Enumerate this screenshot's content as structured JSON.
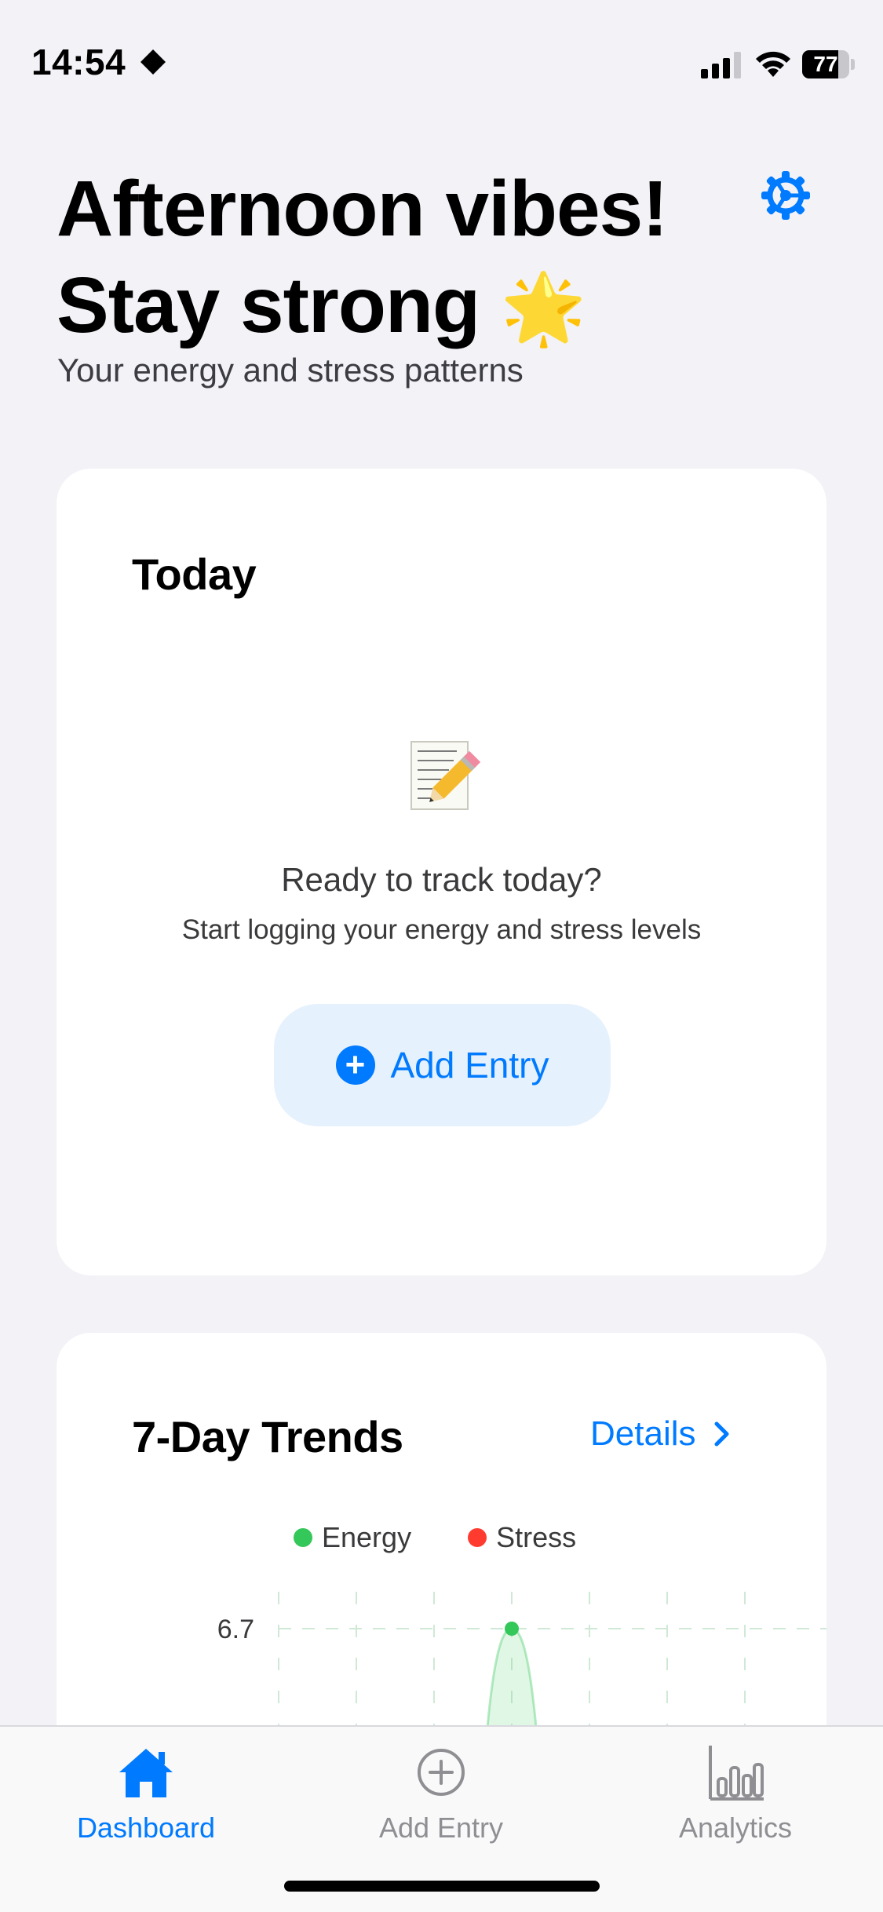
{
  "status_bar": {
    "time": "14:54",
    "battery": "77",
    "battery_level": 0.77,
    "icons": [
      "focus-moon-diamond-icon",
      "cellular-signal-icon",
      "wifi-icon",
      "battery-icon"
    ]
  },
  "header": {
    "greeting_line1": "Afternoon vibes!",
    "greeting_line2": "Stay strong",
    "greeting_emoji": "🌟",
    "subtitle": "Your energy and stress patterns",
    "settings_icon": "gear-icon"
  },
  "today_card": {
    "title": "Today",
    "empty_emoji": "📝",
    "empty_heading": "Ready to track today?",
    "empty_text": "Start logging your energy and stress levels",
    "add_button_label": "Add Entry"
  },
  "trends_card": {
    "title": "7-Day Trends",
    "details_label": "Details",
    "legend": [
      {
        "label": "Energy",
        "color": "#34c759"
      },
      {
        "label": "Stress",
        "color": "#ff3b30"
      }
    ]
  },
  "chart_data": {
    "type": "area",
    "title": "7-Day Trends",
    "series": [
      {
        "name": "Energy",
        "color": "#34c759",
        "points": [
          {
            "day_index": 3,
            "value": 6.7
          }
        ]
      },
      {
        "name": "Stress",
        "color": "#ff3b30",
        "points": []
      }
    ],
    "y_tick_labels": [
      "6.7"
    ],
    "grid": true
  },
  "tab_bar": {
    "tabs": [
      {
        "label": "Dashboard",
        "icon": "house-icon",
        "active": true
      },
      {
        "label": "Add Entry",
        "icon": "plus-circle-icon",
        "active": false
      },
      {
        "label": "Analytics",
        "icon": "bar-chart-icon",
        "active": false
      }
    ]
  },
  "colors": {
    "accent": "#007aff",
    "background": "#f2f2f7",
    "card": "#ffffff"
  }
}
